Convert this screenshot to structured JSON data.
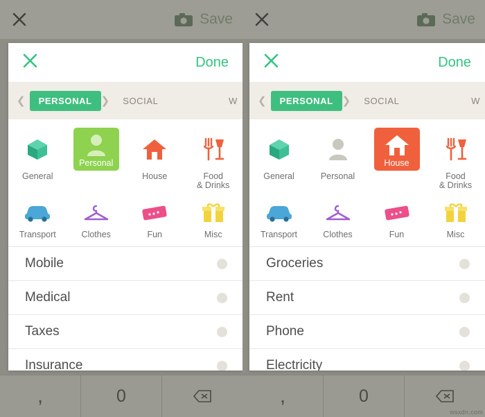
{
  "topbar": {
    "close_icon": "close-icon",
    "camera_icon": "camera-icon",
    "save_label": "Save"
  },
  "keypad": {
    "comma": ",",
    "zero": "0",
    "backspace_icon": "backspace-icon"
  },
  "screens": [
    {
      "id": "left",
      "header": {
        "close_icon": "close-icon",
        "done_label": "Done"
      },
      "tabs": {
        "arrow_icon": "chevron-left-icon",
        "items": [
          {
            "label": "PERSONAL",
            "active": true
          },
          {
            "label": "SOCIAL",
            "active": false
          },
          {
            "label": "W",
            "active": false
          }
        ]
      },
      "icons": [
        {
          "name": "General",
          "icon": "box-icon",
          "selected": false
        },
        {
          "name": "Personal",
          "icon": "person-icon",
          "selected": true
        },
        {
          "name": "House",
          "icon": "house-icon",
          "selected": false
        },
        {
          "name": "Food\n& Drinks",
          "icon": "food-drinks-icon",
          "selected": false
        },
        {
          "name": "Transport",
          "icon": "car-icon",
          "selected": false
        },
        {
          "name": "Clothes",
          "icon": "hanger-icon",
          "selected": false
        },
        {
          "name": "Fun",
          "icon": "ticket-icon",
          "selected": false
        },
        {
          "name": "Misc",
          "icon": "gift-icon",
          "selected": false
        }
      ],
      "list": [
        {
          "label": "Mobile",
          "selected": false
        },
        {
          "label": "Medical",
          "selected": false
        },
        {
          "label": "Taxes",
          "selected": false
        },
        {
          "label": "Insurance",
          "selected": false
        }
      ]
    },
    {
      "id": "right",
      "header": {
        "close_icon": "close-icon",
        "done_label": "Done"
      },
      "tabs": {
        "arrow_icon": "chevron-left-icon",
        "items": [
          {
            "label": "PERSONAL",
            "active": true
          },
          {
            "label": "SOCIAL",
            "active": false
          },
          {
            "label": "W",
            "active": false
          }
        ]
      },
      "icons": [
        {
          "name": "General",
          "icon": "box-icon",
          "selected": false
        },
        {
          "name": "Personal",
          "icon": "person-icon",
          "selected": false
        },
        {
          "name": "House",
          "icon": "house-icon",
          "selected": true
        },
        {
          "name": "Food\n& Drinks",
          "icon": "food-drinks-icon",
          "selected": false
        },
        {
          "name": "Transport",
          "icon": "car-icon",
          "selected": false
        },
        {
          "name": "Clothes",
          "icon": "hanger-icon",
          "selected": false
        },
        {
          "name": "Fun",
          "icon": "ticket-icon",
          "selected": false
        },
        {
          "name": "Misc",
          "icon": "gift-icon",
          "selected": false
        }
      ],
      "list": [
        {
          "label": "Groceries",
          "selected": false
        },
        {
          "label": "Rent",
          "selected": false
        },
        {
          "label": "Phone",
          "selected": false
        },
        {
          "label": "Electricity",
          "selected": false
        }
      ]
    }
  ],
  "colors": {
    "accent_green": "#33c481",
    "selected_green": "#8ed24f",
    "selected_orange": "#f0603d",
    "tab_bg": "#f0ece6"
  },
  "watermark": "wsxdn.com"
}
